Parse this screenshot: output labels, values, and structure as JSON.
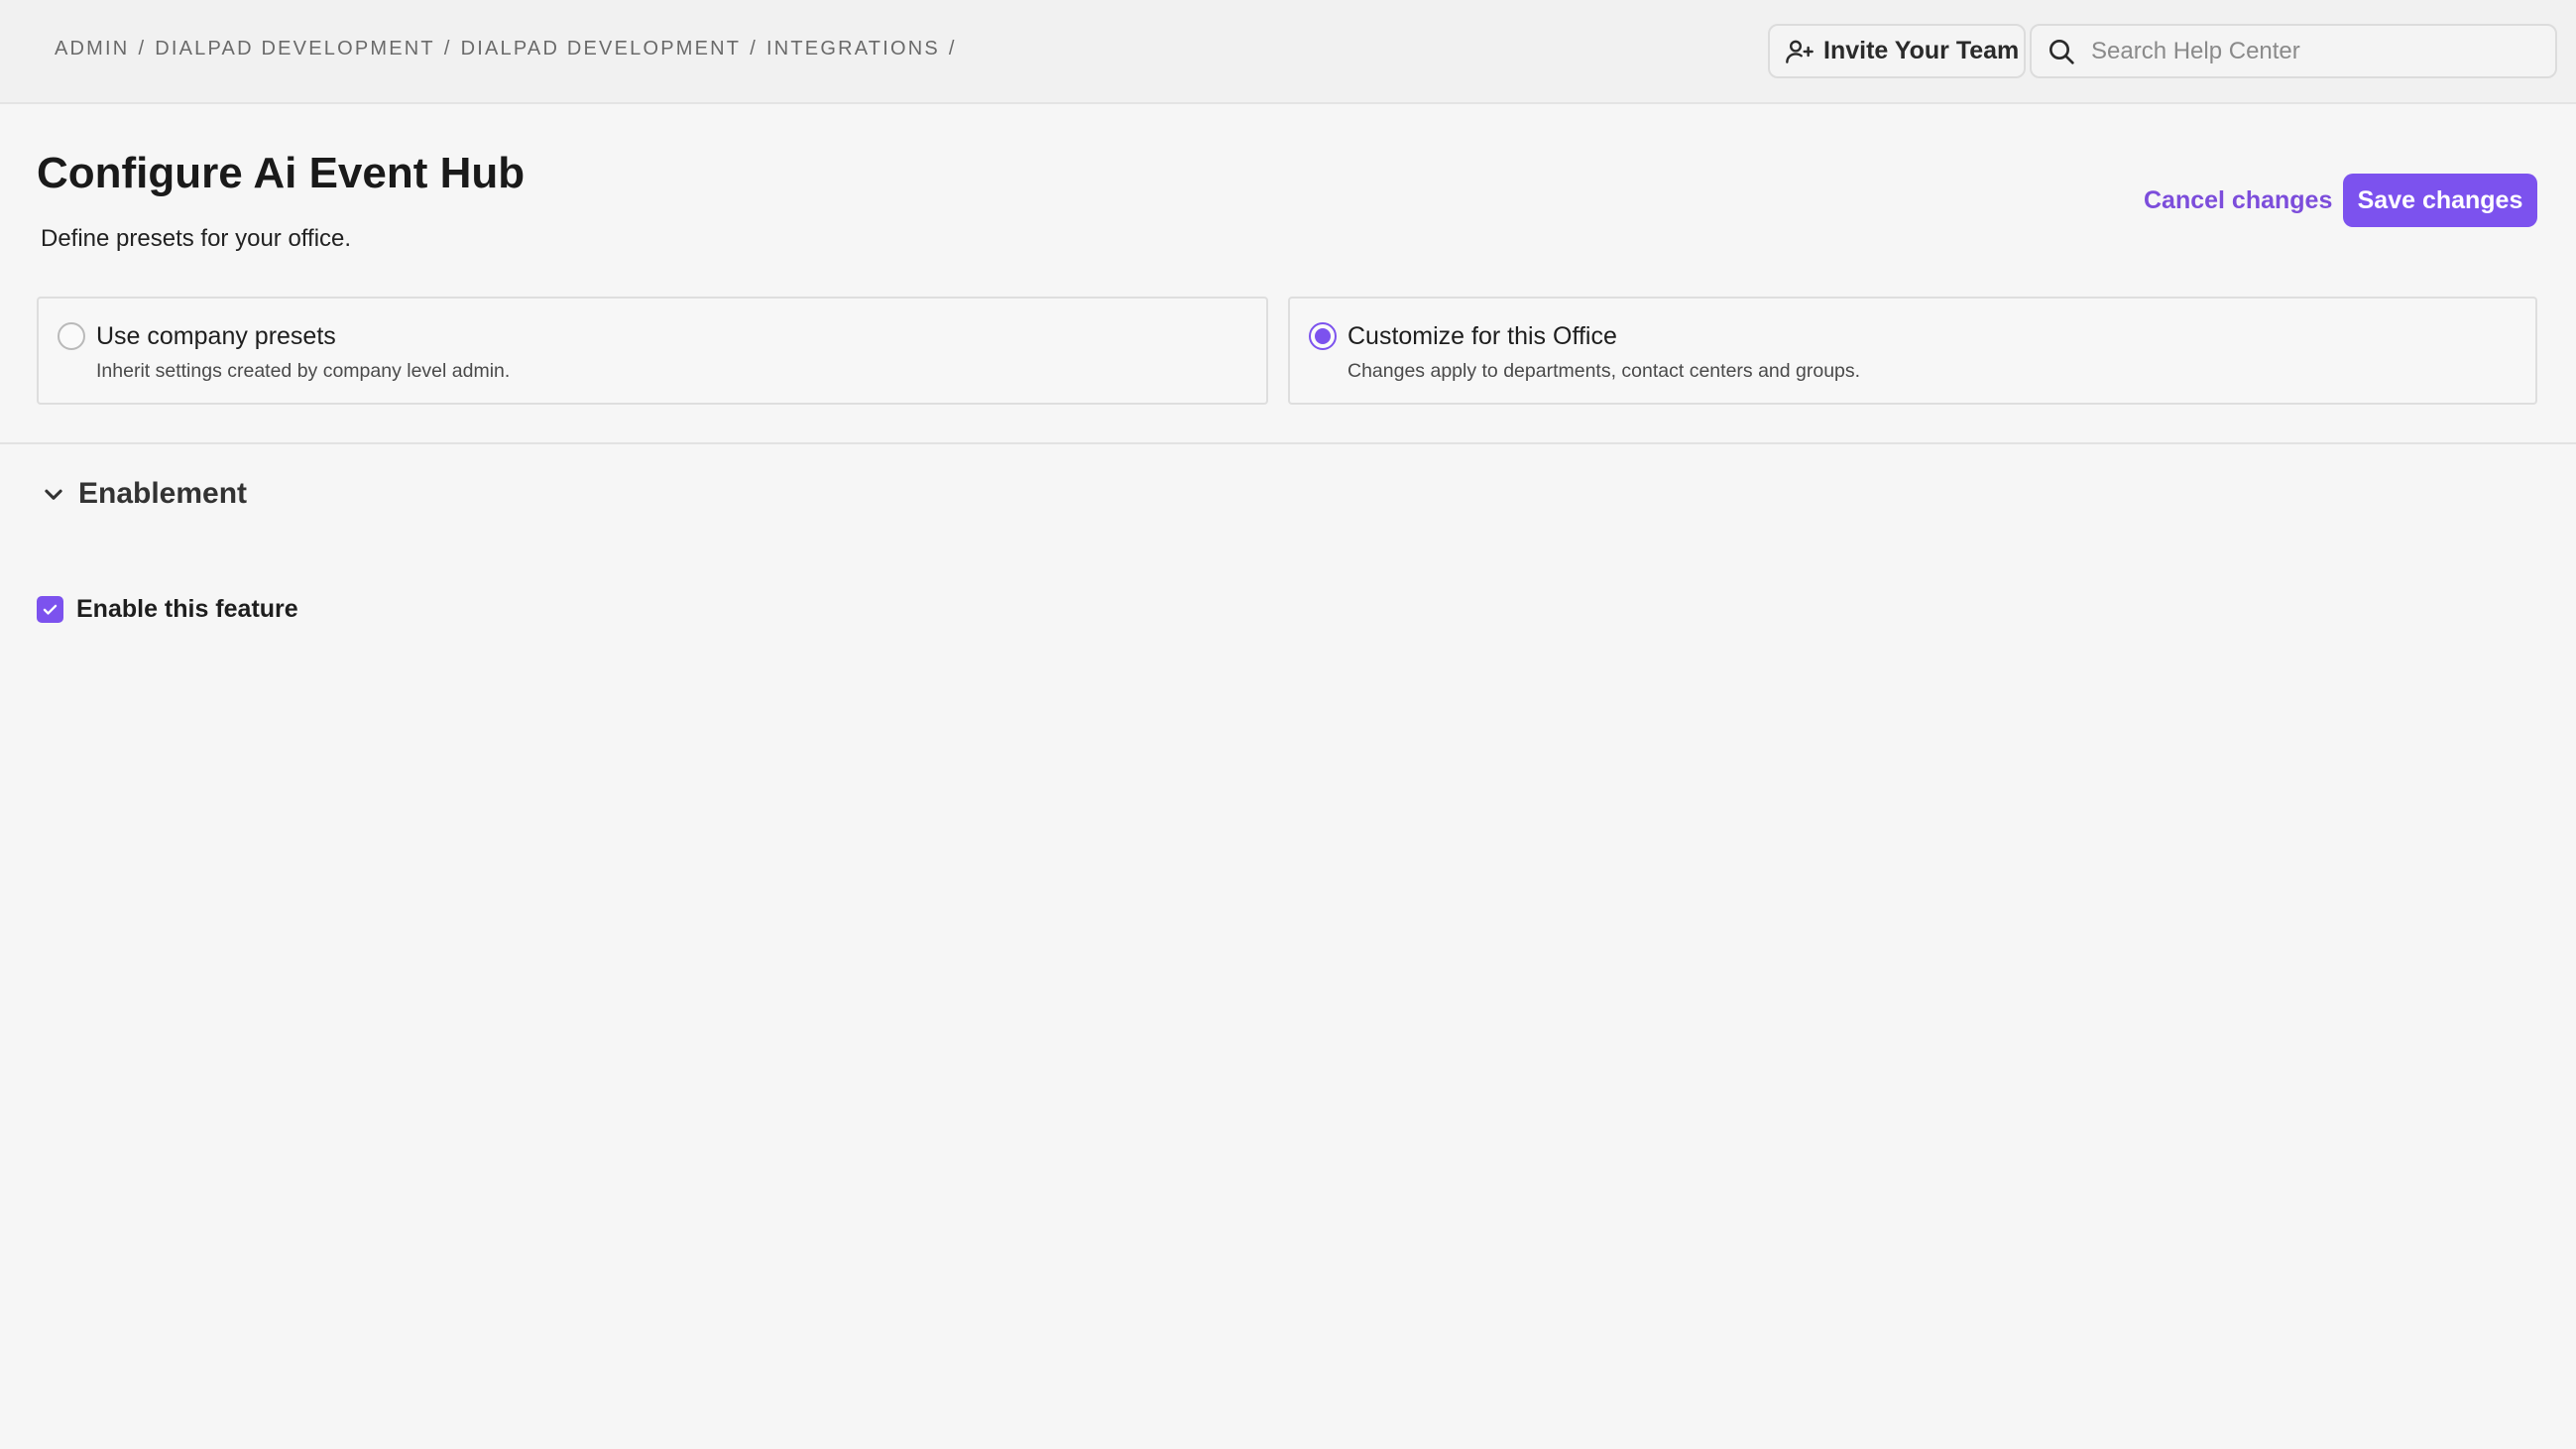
{
  "breadcrumb": {
    "items": [
      "ADMIN",
      "DIALPAD DEVELOPMENT",
      "DIALPAD DEVELOPMENT",
      "INTEGRATIONS"
    ],
    "separator": "/"
  },
  "topbar": {
    "invite_label": "Invite Your Team",
    "invite_icon": "user-plus-icon",
    "search_placeholder": "Search Help Center",
    "search_value": "",
    "search_icon": "search-icon"
  },
  "header": {
    "title": "Configure Ai Event Hub",
    "subtitle": "Define presets for your office."
  },
  "actions": {
    "cancel_label": "Cancel changes",
    "save_label": "Save changes"
  },
  "options": [
    {
      "title": "Use company presets",
      "description": "Inherit settings created by company level admin.",
      "selected": false
    },
    {
      "title": "Customize for this Office",
      "description": "Changes apply to departments, contact centers and groups.",
      "selected": true
    }
  ],
  "enablement": {
    "section_title": "Enablement",
    "expanded": true,
    "checkbox_label": "Enable this feature",
    "checked": true
  },
  "colors": {
    "accent": "#7c52ee",
    "link": "#7c4ddb",
    "background": "#f6f6f6",
    "topbar": "#f1f1f1"
  }
}
